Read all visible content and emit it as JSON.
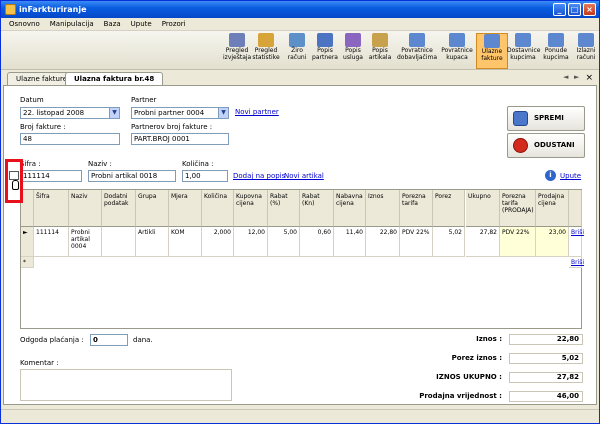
{
  "window": {
    "title": "inFarkturiranje"
  },
  "menu": [
    "Osnovno",
    "Manipulacija",
    "Baza",
    "Upute",
    "Prozori"
  ],
  "toolbar": [
    {
      "line1": "Pregled",
      "line2": "izvještaja",
      "color": "#6c7fb8"
    },
    {
      "line1": "Pregled",
      "line2": "statistike",
      "color": "#d7a43a"
    },
    {
      "line1": "Žiro",
      "line2": "računi",
      "color": "#5d8fc9"
    },
    {
      "line1": "Popis",
      "line2": "partnera",
      "color": "#4c74c2"
    },
    {
      "line1": "Popis",
      "line2": "usluga",
      "color": "#8a66c1"
    },
    {
      "line1": "Popis",
      "line2": "artikala",
      "color": "#c7a14c"
    },
    {
      "line1": "Povratnice",
      "line2": "dobavljačima",
      "color": "#5d87cf"
    },
    {
      "line1": "Povratnice",
      "line2": "kupaca",
      "color": "#5d87cf"
    },
    {
      "line1": "Ulazne",
      "line2": "fakture",
      "color": "#5d87cf",
      "active": true
    },
    {
      "line1": "Dostavnice",
      "line2": "kupcima",
      "color": "#5d87cf"
    },
    {
      "line1": "Ponude",
      "line2": "kupcima",
      "color": "#5d87cf"
    },
    {
      "line1": "Izlazni",
      "line2": "računi",
      "color": "#5d87cf"
    }
  ],
  "tabs": {
    "t1": "Ulazne fakture",
    "t2": "Ulazna faktura br.48"
  },
  "form": {
    "datum_lbl": "Datum",
    "datum": "22. listopad 2008",
    "partner_lbl": "Partner",
    "partner": "Probni partner 0004",
    "novi_partner": "Novi partner",
    "broj_lbl": "Broj fakture :",
    "broj": "48",
    "pbroj_lbl": "Partnerov broj fakture :",
    "pbroj": "PART.BROJ 0001",
    "sifra_lbl": "Šifra :",
    "sifra": "111114",
    "naziv_lbl": "Naziv :",
    "naziv": "Probni artikal 0018",
    "kolicina_lbl": "Količina :",
    "kolicina": "1,00",
    "dodaj": "Dodaj na popis",
    "novi_artikal": "Novi artikal",
    "upute": "Upute"
  },
  "buttons": {
    "spremi": "SPREMI RAČUN",
    "odustani": "ODUSTANI"
  },
  "grid": {
    "headers": [
      "Šifra",
      "Naziv",
      "Dodatni podatak",
      "Grupa",
      "Mjera",
      "Količina",
      "Kupovna cijena",
      "Rabat (%)",
      "Rabat (Kn)",
      "Nabavna cijena",
      "Iznos",
      "Porezna tarifa",
      "Porez",
      "Ukupno",
      "Porezna tarifa (PRODAJA)",
      "Prodajna cijena",
      ""
    ],
    "row": [
      "111114",
      "Probni artikal 0004",
      "",
      "Artikli",
      "KOM",
      "2,000",
      "12,00",
      "5,00",
      "0,60",
      "11,40",
      "22,80",
      "PDV 22%",
      "5,02",
      "27,82",
      "PDV 22%",
      "23,00",
      "Briši"
    ],
    "new_row_link": "Briši"
  },
  "bottom": {
    "odgoda_lbl": "Odgoda plaćanja :",
    "odgoda": "0",
    "dana": "dana.",
    "komentar_lbl": "Komentar :"
  },
  "summary": [
    {
      "label": "Iznos :",
      "value": "22,80"
    },
    {
      "label": "Porez iznos :",
      "value": "5,02"
    },
    {
      "label": "IZNOS UKUPNO :",
      "value": "27,82"
    },
    {
      "label": "Prodajna vrijednost :",
      "value": "46,00"
    }
  ]
}
